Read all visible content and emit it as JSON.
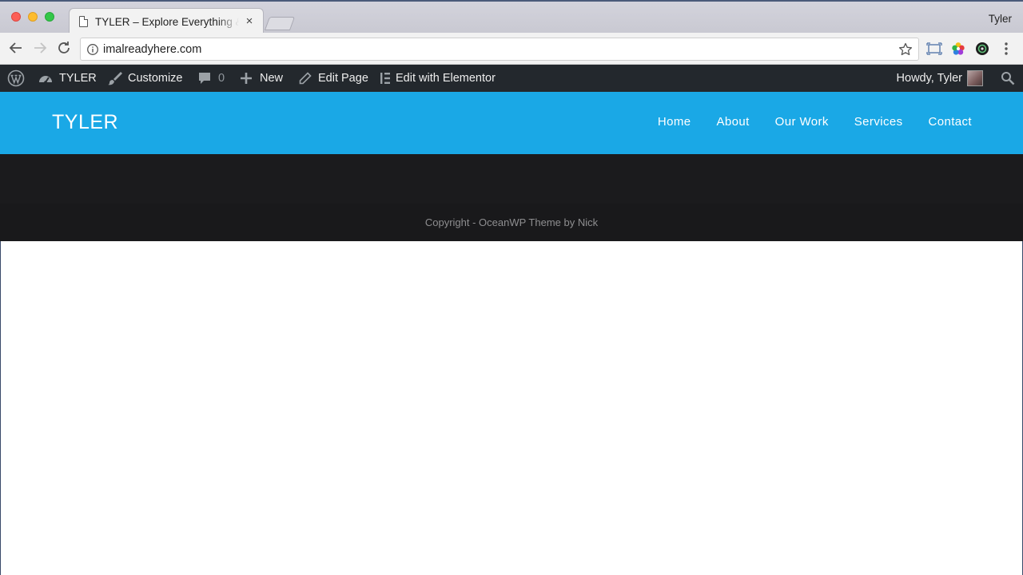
{
  "browser": {
    "tab_title": "TYLER – Explore Everything & Discover",
    "profile_name": "Tyler",
    "url": "imalreadyhere.com"
  },
  "admin_bar": {
    "site_name": "TYLER",
    "customize": "Customize",
    "comments_count": "0",
    "new": "New",
    "edit_page": "Edit Page",
    "edit_with_elementor": "Edit with Elementor",
    "greeting": "Howdy, Tyler"
  },
  "site": {
    "logo": "TYLER",
    "nav": [
      "Home",
      "About",
      "Our Work",
      "Services",
      "Contact"
    ],
    "accent_color": "#1aa8e6"
  },
  "footer": {
    "copyright": "Copyright - OceanWP Theme by Nick"
  }
}
